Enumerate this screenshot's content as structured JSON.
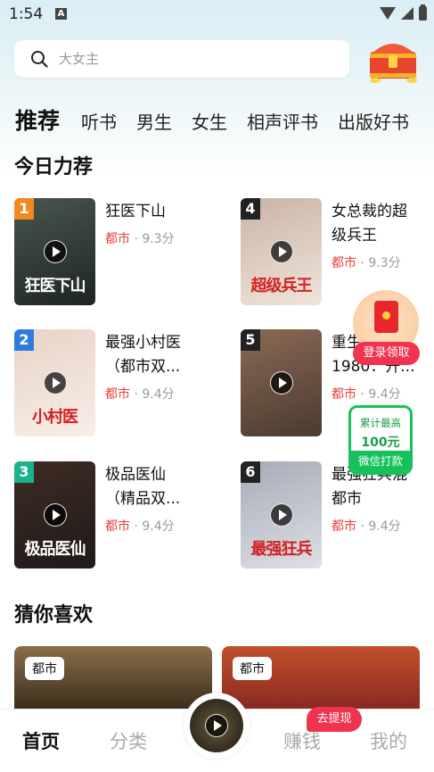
{
  "status": {
    "time": "1:54",
    "icon": "A"
  },
  "search": {
    "placeholder": "大女主"
  },
  "tabs": [
    "推荐",
    "听书",
    "男生",
    "女生",
    "相声评书",
    "出版好书"
  ],
  "today": {
    "title": "今日力荐",
    "books": [
      {
        "rank": "1",
        "title_line1": "狂医下山",
        "title_line2": "",
        "category": "都市",
        "score": " · 9.3分",
        "cover_text": "狂医下山",
        "cover_colors": [
          "#1d2522",
          "#4a5650"
        ],
        "rank_color": "#f08a1c"
      },
      {
        "rank": "4",
        "title_line1": "女总裁的超",
        "title_line2": "级兵王",
        "category": "都市",
        "score": " · 9.3分",
        "cover_text": "超级兵王",
        "cover_colors": [
          "#f0e4da",
          "#c9b4a6"
        ],
        "rank_color": "#222222"
      },
      {
        "rank": "2",
        "title_line1": "最强小村医",
        "title_line2": "（都市双...",
        "category": "都市",
        "score": " · 9.4分",
        "cover_text": "小村医",
        "cover_colors": [
          "#f7eee8",
          "#e8d3c6"
        ],
        "rank_color": "#2d7de0"
      },
      {
        "rank": "5",
        "title_line1": "重生",
        "title_line2": "1980：开...",
        "category": "都市",
        "score": " · 9.4分",
        "cover_text": "",
        "cover_colors": [
          "#4a3a30",
          "#8b6a55"
        ],
        "rank_color": "#222222"
      },
      {
        "rank": "3",
        "title_line1": "极品医仙",
        "title_line2": "（精品双...",
        "category": "都市",
        "score": " · 9.4分",
        "cover_text": "极品医仙",
        "cover_colors": [
          "#1e1a1a",
          "#3e2c22"
        ],
        "rank_color": "#1bb38a"
      },
      {
        "rank": "6",
        "title_line1": "最强狂兵混",
        "title_line2": "都市",
        "category": "都市",
        "score": " · 9.4分",
        "cover_text": "最强狂兵",
        "cover_colors": [
          "#dde0e6",
          "#a8aab6"
        ],
        "rank_color": "#222222"
      }
    ]
  },
  "guess": {
    "title": "猜你喜欢",
    "cards": [
      {
        "tag": "都市",
        "colors": [
          "#3c2e1e",
          "#8a6e48"
        ]
      },
      {
        "tag": "都市",
        "colors": [
          "#8a2a22",
          "#c1502a"
        ]
      }
    ]
  },
  "floats": {
    "login_claim": "登录领取",
    "wechat_line1": "累计最高",
    "wechat_line2": "100元",
    "wechat_button": "微信打款"
  },
  "nav": {
    "items": [
      "首页",
      "分类",
      "赚钱",
      "我的"
    ],
    "withdraw": "去提现"
  },
  "colors": {
    "accent_red": "#e8413a",
    "wechat_green": "#16c15c",
    "badge_pink": "#f03450"
  }
}
